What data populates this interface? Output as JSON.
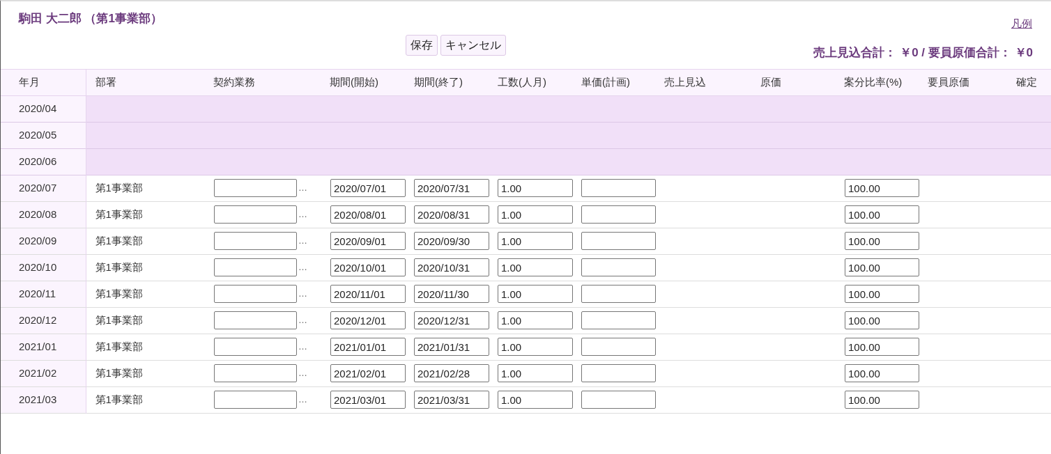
{
  "header": {
    "title": "駒田 大二郎 （第1事業部）",
    "legend_link": "凡例",
    "buttons": [
      "保存",
      "キャンセル"
    ],
    "totals": "売上見込合計： ￥0 / 要員原価合計： ￥0"
  },
  "table": {
    "columns": [
      "年月",
      "部署",
      "契約業務",
      "期間(開始)",
      "期間(終了)",
      "工数(人月)",
      "単価(計画)",
      "売上見込",
      "原価",
      "案分比率(%)",
      "要員原価",
      "確定"
    ],
    "rows": [
      {
        "kind": "locked",
        "month": "2020/04"
      },
      {
        "kind": "locked",
        "month": "2020/05"
      },
      {
        "kind": "locked",
        "month": "2020/06"
      },
      {
        "kind": "editable",
        "month": "2020/07",
        "department": "第1事業部",
        "picker": "…",
        "start": "2020/07/01",
        "end": "2020/07/31",
        "effort": "1.00",
        "ratio": "100.00"
      },
      {
        "kind": "editable",
        "month": "2020/08",
        "department": "第1事業部",
        "picker": "…",
        "start": "2020/08/01",
        "end": "2020/08/31",
        "effort": "1.00",
        "ratio": "100.00"
      },
      {
        "kind": "editable",
        "month": "2020/09",
        "department": "第1事業部",
        "picker": "…",
        "start": "2020/09/01",
        "end": "2020/09/30",
        "effort": "1.00",
        "ratio": "100.00"
      },
      {
        "kind": "editable",
        "month": "2020/10",
        "department": "第1事業部",
        "picker": "…",
        "start": "2020/10/01",
        "end": "2020/10/31",
        "effort": "1.00",
        "ratio": "100.00"
      },
      {
        "kind": "editable",
        "month": "2020/11",
        "department": "第1事業部",
        "picker": "…",
        "start": "2020/11/01",
        "end": "2020/11/30",
        "effort": "1.00",
        "ratio": "100.00"
      },
      {
        "kind": "editable",
        "month": "2020/12",
        "department": "第1事業部",
        "picker": "…",
        "start": "2020/12/01",
        "end": "2020/12/31",
        "effort": "1.00",
        "ratio": "100.00"
      },
      {
        "kind": "editable",
        "month": "2021/01",
        "department": "第1事業部",
        "picker": "…",
        "start": "2021/01/01",
        "end": "2021/01/31",
        "effort": "1.00",
        "ratio": "100.00"
      },
      {
        "kind": "editable",
        "month": "2021/02",
        "department": "第1事業部",
        "picker": "…",
        "start": "2021/02/01",
        "end": "2021/02/28",
        "effort": "1.00",
        "ratio": "100.00"
      },
      {
        "kind": "editable",
        "month": "2021/03",
        "department": "第1事業部",
        "picker": "…",
        "start": "2021/03/01",
        "end": "2021/03/31",
        "effort": "1.00",
        "ratio": "100.00"
      }
    ]
  }
}
